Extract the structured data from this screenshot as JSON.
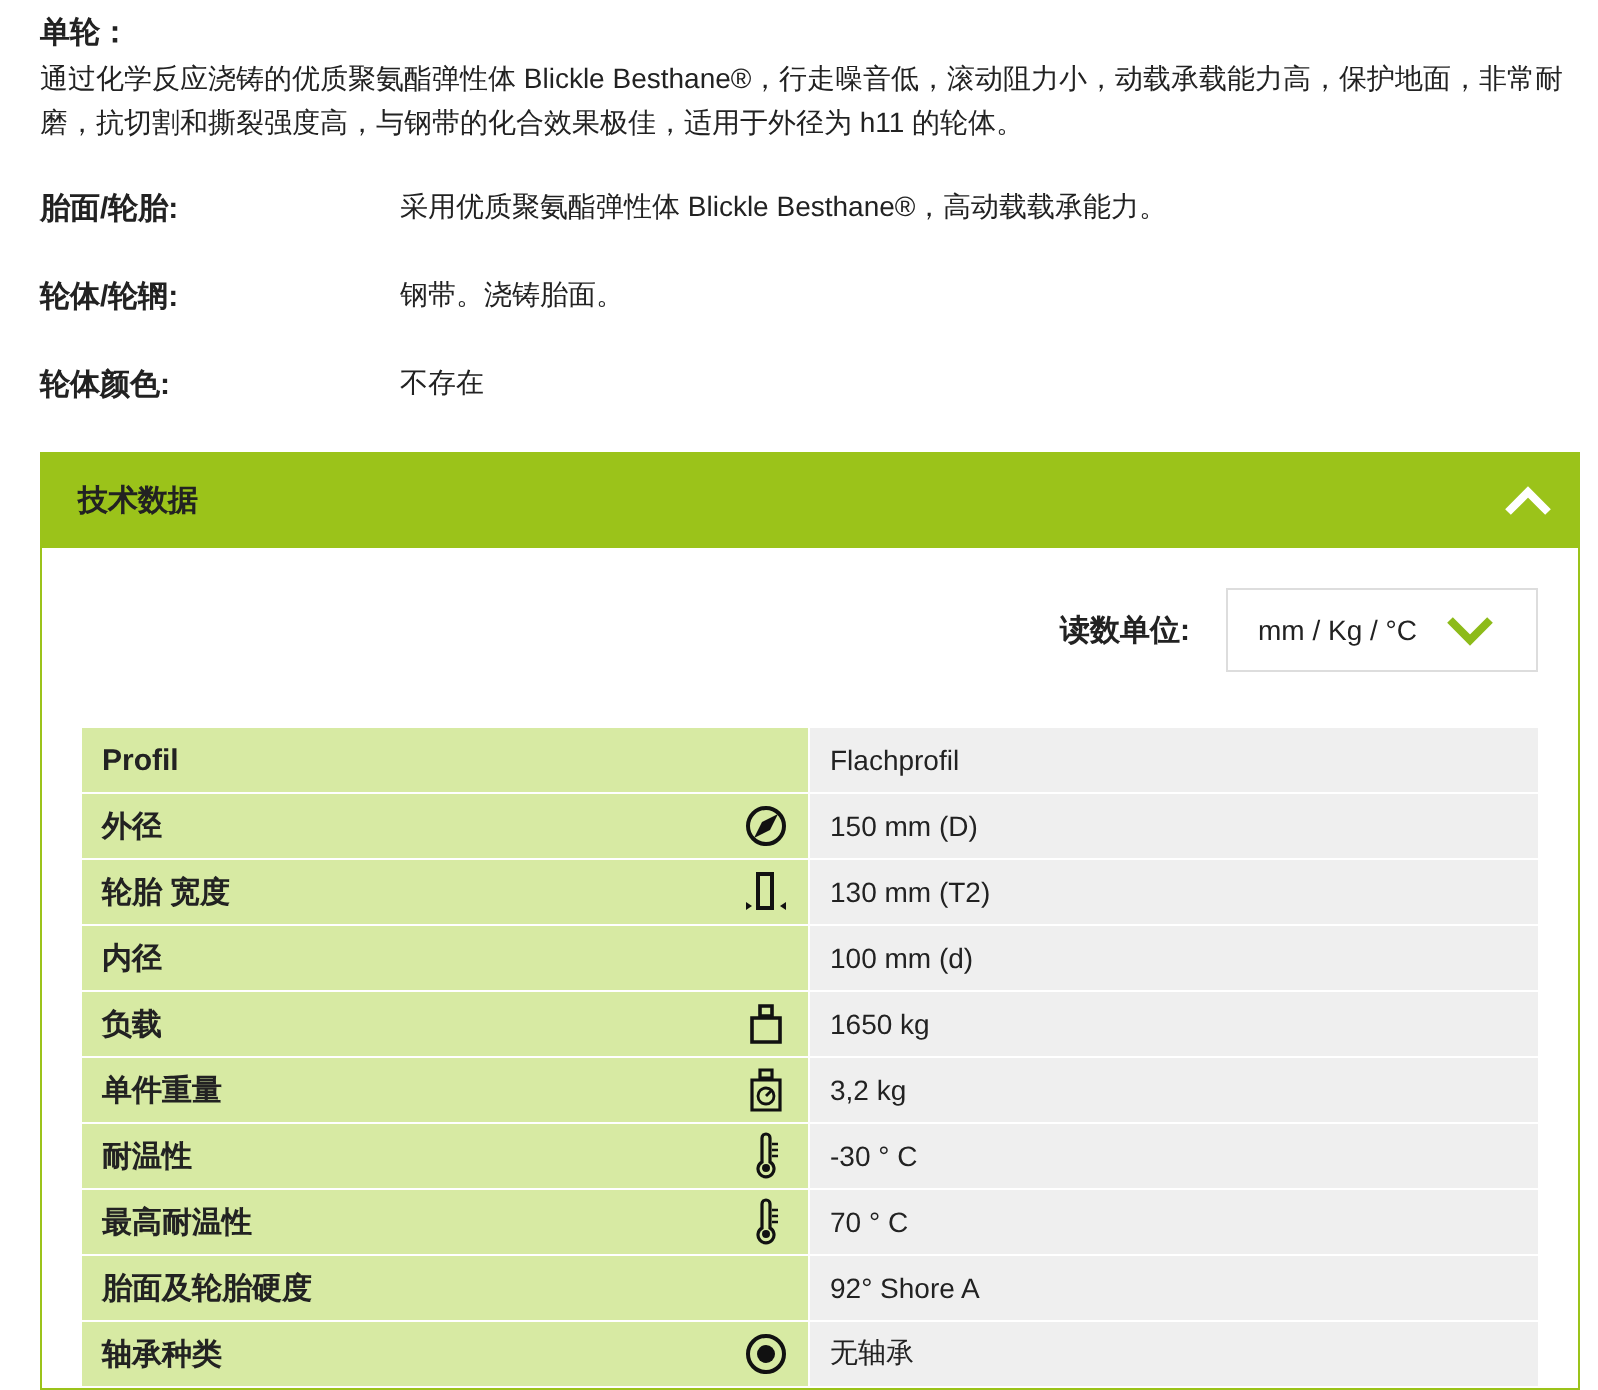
{
  "wheel": {
    "title": "单轮：",
    "description": "通过化学反应浇铸的优质聚氨酯弹性体 Blickle Besthane®，行走噪音低，滚动阻力小，动载承载能力高，保护地面，非常耐磨，抗切割和撕裂强度高，与钢带的化合效果极佳，适用于外径为 h11 的轮体。"
  },
  "properties": [
    {
      "label": "胎面/轮胎:",
      "value": "采用优质聚氨酯弹性体 Blickle Besthane®，高动载载承能力。"
    },
    {
      "label": "轮体/轮辋:",
      "value": "钢带。浇铸胎面。"
    },
    {
      "label": "轮体颜色:",
      "value": "不存在"
    }
  ],
  "tech_panel": {
    "title": "技术数据",
    "expanded": true,
    "units": {
      "label": "读数单位:",
      "value": "mm / Kg / °C"
    },
    "rows": [
      {
        "label": "Profil",
        "kind": "none",
        "value": "Flachprofil"
      },
      {
        "label": "外径",
        "kind": "diameter",
        "value": "150 mm (D)"
      },
      {
        "label": "轮胎 宽度",
        "kind": "width",
        "value": "130 mm (T2)"
      },
      {
        "label": "内径",
        "kind": "none",
        "value": "100 mm (d)"
      },
      {
        "label": "负载",
        "kind": "load",
        "value": "1650 kg"
      },
      {
        "label": "单件重量",
        "kind": "weight",
        "value": "3,2 kg"
      },
      {
        "label": "耐温性",
        "kind": "thermometer",
        "value": "-30 ° C"
      },
      {
        "label": "最高耐温性",
        "kind": "thermometer",
        "value": "70 ° C"
      },
      {
        "label": "胎面及轮胎硬度",
        "kind": "none",
        "value": "92° Shore A"
      },
      {
        "label": "轴承种类",
        "kind": "bearing",
        "value": "无轴承"
      }
    ]
  }
}
